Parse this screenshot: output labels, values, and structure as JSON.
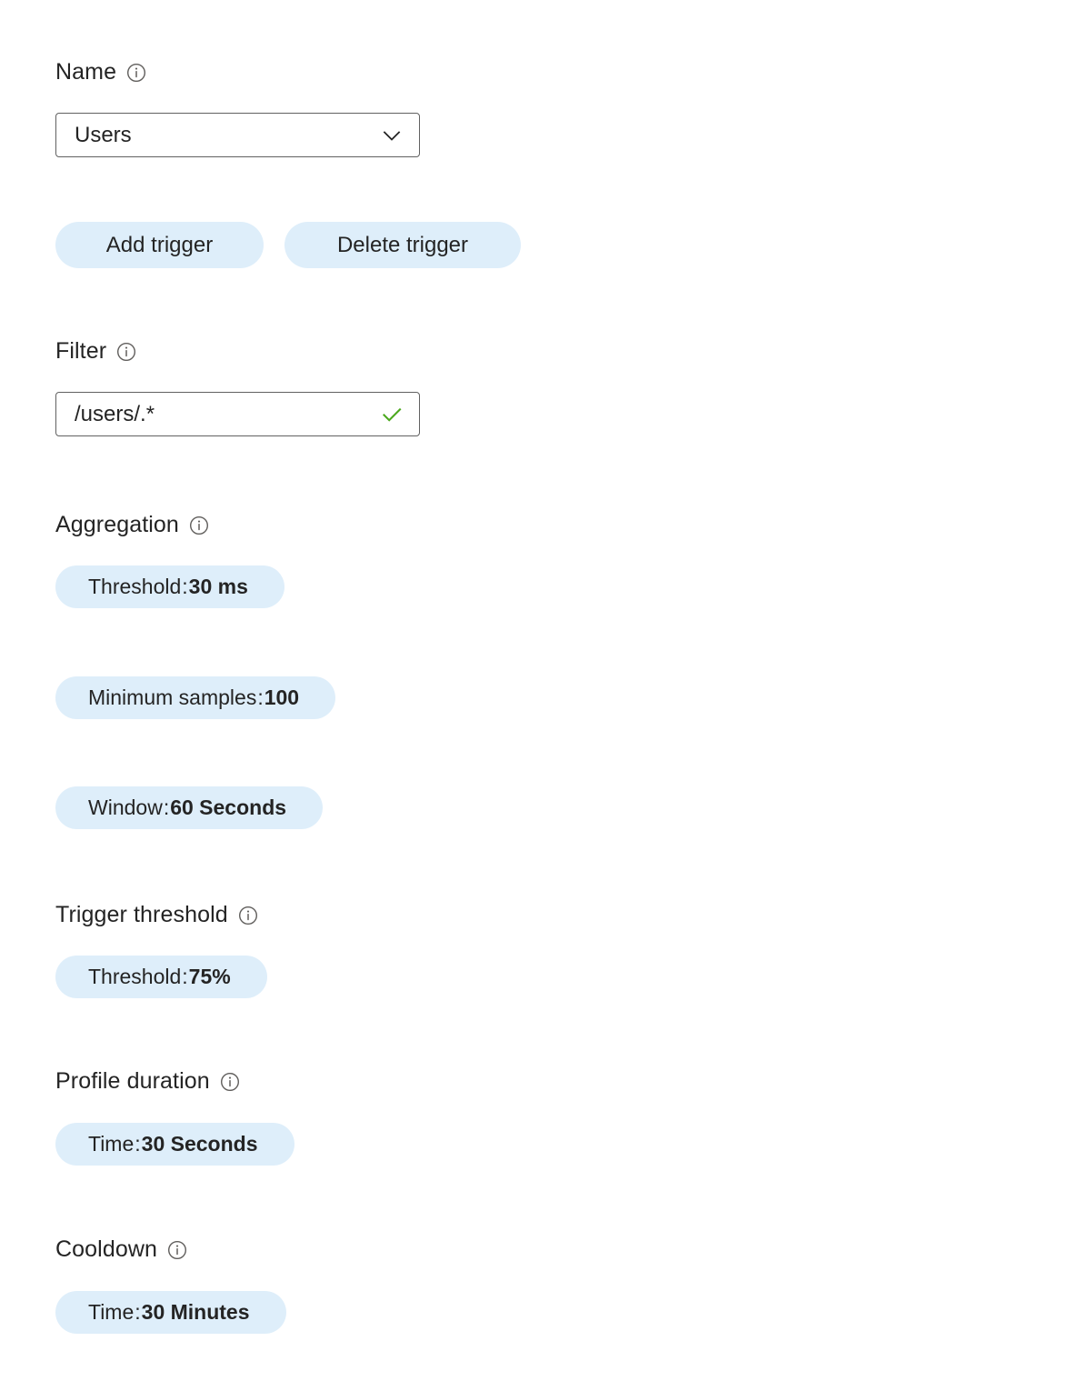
{
  "theme": {
    "pill_bg": "#deeefa",
    "input_border": "#616161",
    "text": "#242424",
    "valid_check": "#4aa81c",
    "info_icon": "#605e5c",
    "background": "#ffffff"
  },
  "form": {
    "name": {
      "label": "Name",
      "info_icon": "info-circle-icon",
      "dropdown": {
        "value": "Users",
        "chevron_icon": "chevron-down-icon"
      }
    },
    "actions": [
      {
        "id": "add-trigger",
        "label": "Add trigger"
      },
      {
        "id": "delete-trigger",
        "label": "Delete trigger"
      }
    ],
    "filter": {
      "label": "Filter",
      "info_icon": "info-circle-icon",
      "value": "/users/.*",
      "validation_icon": "checkmark-icon"
    },
    "aggregation": {
      "label": "Aggregation",
      "info_icon": "info-circle-icon",
      "items": [
        {
          "key": "Threshold",
          "separator": ":",
          "value": "30 ms"
        },
        {
          "key": "Minimum samples",
          "separator": ":",
          "value": "100"
        },
        {
          "key": "Window",
          "separator": ":",
          "value": "60 Seconds"
        }
      ]
    },
    "trigger_threshold": {
      "label": "Trigger threshold",
      "info_icon": "info-circle-icon",
      "items": [
        {
          "key": "Threshold",
          "separator": ":",
          "value": "75%"
        }
      ]
    },
    "profile_duration": {
      "label": "Profile duration",
      "info_icon": "info-circle-icon",
      "items": [
        {
          "key": "Time",
          "separator": ":",
          "value": "30 Seconds"
        }
      ]
    },
    "cooldown": {
      "label": "Cooldown",
      "info_icon": "info-circle-icon",
      "items": [
        {
          "key": "Time",
          "separator": ":",
          "value": "30 Minutes"
        }
      ]
    }
  }
}
